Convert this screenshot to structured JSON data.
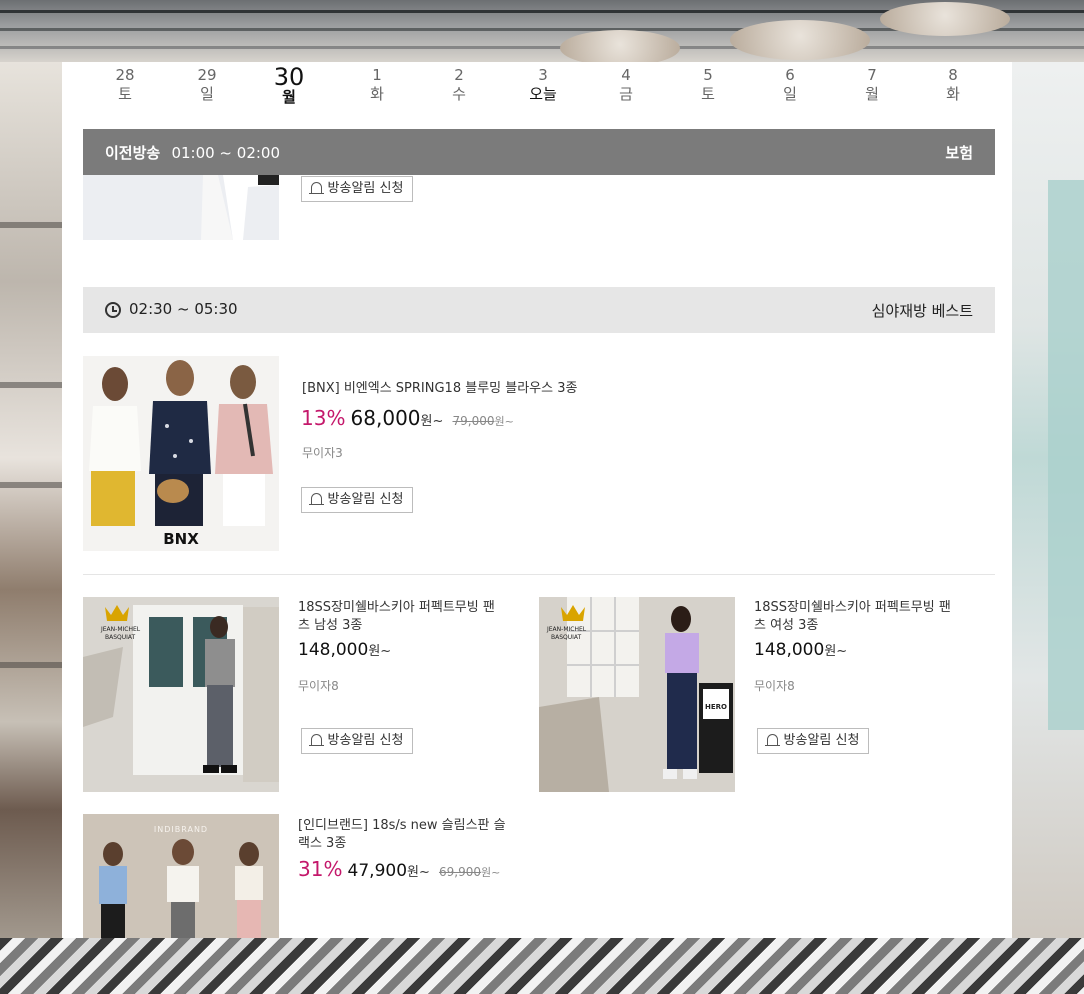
{
  "dates": [
    {
      "num": "28",
      "dow": "토"
    },
    {
      "num": "29",
      "dow": "일"
    },
    {
      "num": "30",
      "dow": "월"
    },
    {
      "num": "1",
      "dow": "화"
    },
    {
      "num": "2",
      "dow": "수"
    },
    {
      "num": "3",
      "dow": "오늘"
    },
    {
      "num": "4",
      "dow": "금"
    },
    {
      "num": "5",
      "dow": "토"
    },
    {
      "num": "6",
      "dow": "일"
    },
    {
      "num": "7",
      "dow": "월"
    },
    {
      "num": "8",
      "dow": "화"
    }
  ],
  "prev_broadcast": {
    "label": "이전방송",
    "time": "01:00 ~ 02:00",
    "category": "보험"
  },
  "current_broadcast": {
    "time": "02:30 ~ 05:30",
    "category": "심야재방 베스트"
  },
  "alarm_label": "방송알림 신청",
  "products": [
    {
      "title": "[BNX] 비엔엑스 SPRING18 블루밍 블라우스 3종",
      "discount": "13%",
      "price": "68,000",
      "won": "원~",
      "original": "79,000",
      "original_won": "원~",
      "installment": "무이자3",
      "brand": "BNX"
    },
    {
      "title": "18SS장미쉘바스키아 퍼펙트무빙 팬츠 남성 3종",
      "price": "148,000",
      "won": "원~",
      "installment": "무이자8",
      "brand": "JEAN-MICHEL BASQUIAT"
    },
    {
      "title": "18SS장미쉘바스키아 퍼펙트무빙 팬츠 여성 3종",
      "price": "148,000",
      "won": "원~",
      "installment": "무이자8",
      "brand": "JEAN-MICHEL BASQUIAT",
      "sign": "HERO"
    },
    {
      "title": "[인디브랜드] 18s/s new 슬림스판 슬랙스 3종",
      "discount": "31%",
      "price": "47,900",
      "won": "원~",
      "original": "69,900",
      "original_won": "원~",
      "brand": "INDIBRAND"
    }
  ],
  "colors": {
    "discount": "#c4186b",
    "prev_bar": "#7b7b7b",
    "cur_bar": "#e6e6e6"
  }
}
